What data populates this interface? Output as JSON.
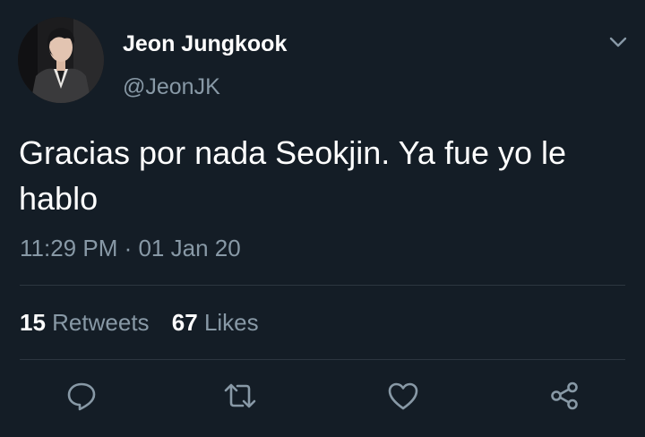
{
  "tweet": {
    "display_name": "Jeon Jungkook",
    "handle": "@JeonJK",
    "text": "Gracias por nada Seokjin. Ya fue yo le hablo",
    "timestamp": "11:29 PM · 01 Jan 20"
  },
  "stats": {
    "retweets_count": "15",
    "retweets_label": "Retweets",
    "likes_count": "67",
    "likes_label": "Likes"
  },
  "icons": {
    "caret": "chevron-down-icon",
    "reply": "reply-icon",
    "retweet": "retweet-icon",
    "like": "heart-icon",
    "share": "share-icon"
  },
  "colors": {
    "background": "#141d26",
    "primary_text": "#ffffff",
    "secondary_text": "#8899a6",
    "divider": "#2c3640"
  }
}
